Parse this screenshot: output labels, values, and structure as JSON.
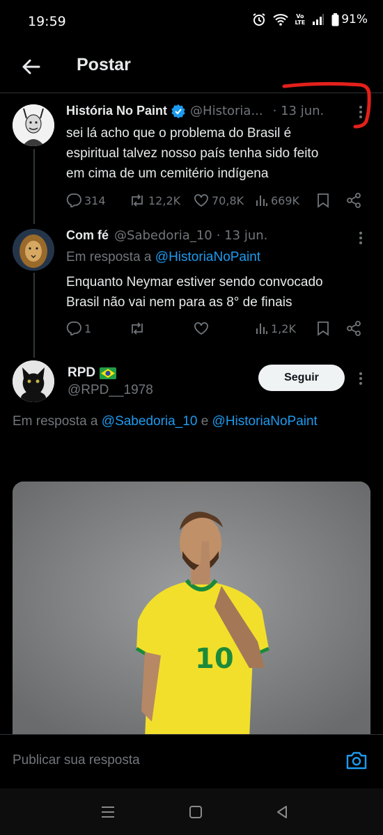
{
  "status_bar": {
    "time": "19:59",
    "network_label_top": "Vo",
    "network_label_bottom": "LTE",
    "battery": "91%"
  },
  "header": {
    "title": "Postar"
  },
  "tweets": [
    {
      "name": "História No Paint",
      "handle": "@Historia...",
      "verified": true,
      "date": "· 13 jun.",
      "text_lines": [
        "sei lá acho que o problema do Brasil é",
        "espiritual talvez nosso país tenha sido feito",
        "em cima de um cemitério indígena"
      ],
      "replies": "314",
      "retweets": "12,2K",
      "likes": "70,8K",
      "views": "669K"
    },
    {
      "name": "Com fé",
      "handle": "@Sabedoria_10",
      "date": "· 13 jun.",
      "reply_prefix": "Em resposta a",
      "reply_to": "@HistoriaNoPaint",
      "text_lines": [
        "Enquanto Neymar estiver sendo convocado",
        "Brasil não vai nem para as 8° de finais"
      ],
      "replies": "1",
      "retweets": "",
      "likes": "",
      "views": "1,2K"
    }
  ],
  "main_post": {
    "name": "RPD",
    "flag": "🇧🇷",
    "handle": "@RPD__1978",
    "follow_label": "Seguir",
    "reply_prefix": "Em resposta a",
    "reply_to_1": "@Sabedoria_10",
    "reply_conjunction": "e",
    "reply_to_2": "@HistoriaNoPaint",
    "jersey_number": "10"
  },
  "reply_bar": {
    "placeholder": "Publicar sua resposta"
  },
  "colors": {
    "accent": "#1d9bf0",
    "muted": "#71767b",
    "annotation": "#e3201b",
    "jersey": "#f2df2b"
  },
  "icons": [
    "alarm-icon",
    "wifi-icon",
    "signal-icon",
    "battery-icon",
    "back-arrow-icon",
    "verified-icon",
    "more-icon",
    "reply-icon",
    "retweet-icon",
    "like-icon",
    "views-icon",
    "bookmark-icon",
    "share-icon",
    "camera-icon",
    "menu-icon",
    "home-icon",
    "back-icon"
  ]
}
